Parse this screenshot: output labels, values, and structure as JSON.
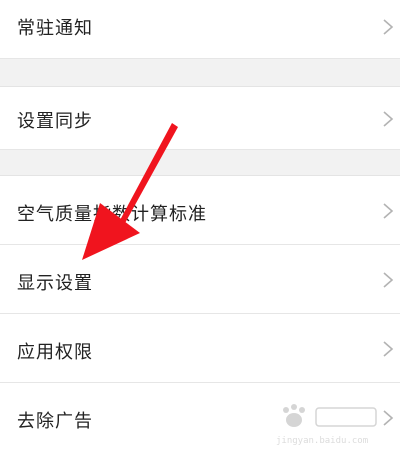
{
  "settings": {
    "items": [
      {
        "label": "常驻通知"
      },
      {
        "label": "设置同步"
      },
      {
        "label": "空气质量指数计算标准"
      },
      {
        "label": "显示设置"
      },
      {
        "label": "应用权限"
      },
      {
        "label": "去除广告"
      }
    ]
  },
  "icons": {
    "chevron": "chevron-right-icon",
    "annotation": "red-arrow-icon"
  },
  "colors": {
    "separator": "#f2f2f2",
    "text": "#222222",
    "chevron": "#b3b3b3",
    "arrow": "#f0141e"
  },
  "watermark": {
    "text": "jingyan.baidu.com"
  }
}
